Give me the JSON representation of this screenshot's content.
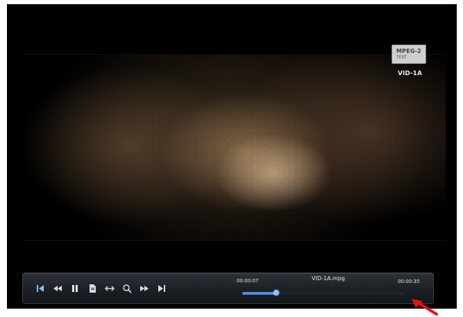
{
  "player": {
    "file_name": "VID-1A.mpg",
    "current_time": "00:00:07",
    "total_time": "00:00:35",
    "progress": 0.209
  },
  "overlay": {
    "logo_line1": "MPEG-2",
    "logo_line2": "TEST",
    "channel_label": "VID-1A"
  },
  "controls": [
    {
      "icon": "skip-start-icon"
    },
    {
      "icon": "rewind-icon"
    },
    {
      "icon": "pause-icon"
    },
    {
      "icon": "document-icon"
    },
    {
      "icon": "loop-icon"
    },
    {
      "icon": "search-icon"
    },
    {
      "icon": "fast-forward-icon"
    },
    {
      "icon": "skip-end-icon"
    }
  ],
  "colors": {
    "accent": "#4b8fe7",
    "bar_bg": "#1c2025",
    "annotation_arrow": "#e51212"
  }
}
